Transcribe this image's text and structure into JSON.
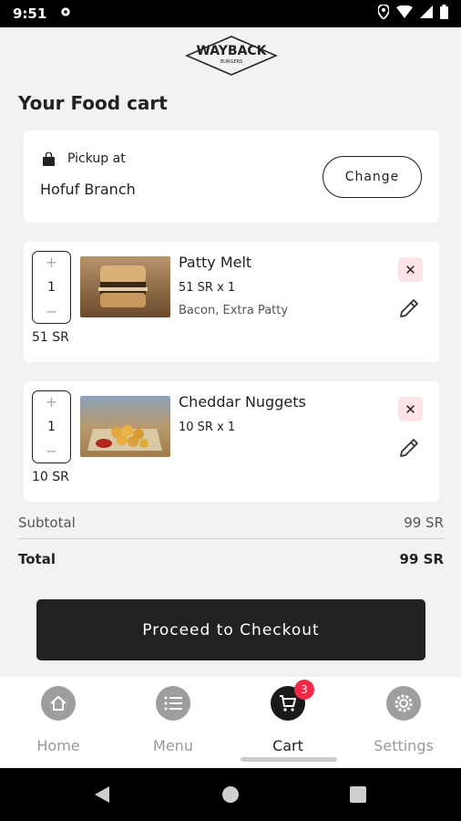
{
  "status_bar": {
    "time": "9:51",
    "icons": [
      "settings-icon",
      "location-icon",
      "wifi-icon",
      "signal-icon",
      "battery-icon"
    ]
  },
  "logo": {
    "brand": "WAYBACK",
    "sub": "BURGERS"
  },
  "page": {
    "title": "Your Food cart"
  },
  "pickup": {
    "label": "Pickup at",
    "branch": "Hofuf Branch",
    "change_label": "Change"
  },
  "items": [
    {
      "name": "Patty Melt",
      "qty_price": "51 SR x 1",
      "extras": "Bacon, Extra Patty",
      "quantity": "1",
      "line_total": "51 SR",
      "plus": "+",
      "minus": "−",
      "remove": "✕"
    },
    {
      "name": "Cheddar Nuggets",
      "qty_price": "10 SR x 1",
      "extras": "",
      "quantity": "1",
      "line_total": "10 SR",
      "plus": "+",
      "minus": "−",
      "remove": "✕"
    }
  ],
  "summary": {
    "subtotal_label": "Subtotal",
    "subtotal_value": "99 SR",
    "total_label": "Total",
    "total_value": "99 SR"
  },
  "checkout": {
    "label": "Proceed to Checkout"
  },
  "nav": {
    "items": [
      {
        "label": "Home",
        "icon": "home-icon"
      },
      {
        "label": "Menu",
        "icon": "list-icon"
      },
      {
        "label": "Cart",
        "icon": "cart-icon",
        "badge": "3",
        "active": true
      },
      {
        "label": "Settings",
        "icon": "gear-icon"
      }
    ]
  },
  "colors": {
    "accent_dark": "#222222",
    "badge_red": "#ef2b47",
    "remove_bg": "#fbe3e7",
    "background": "#f2f2f2"
  }
}
